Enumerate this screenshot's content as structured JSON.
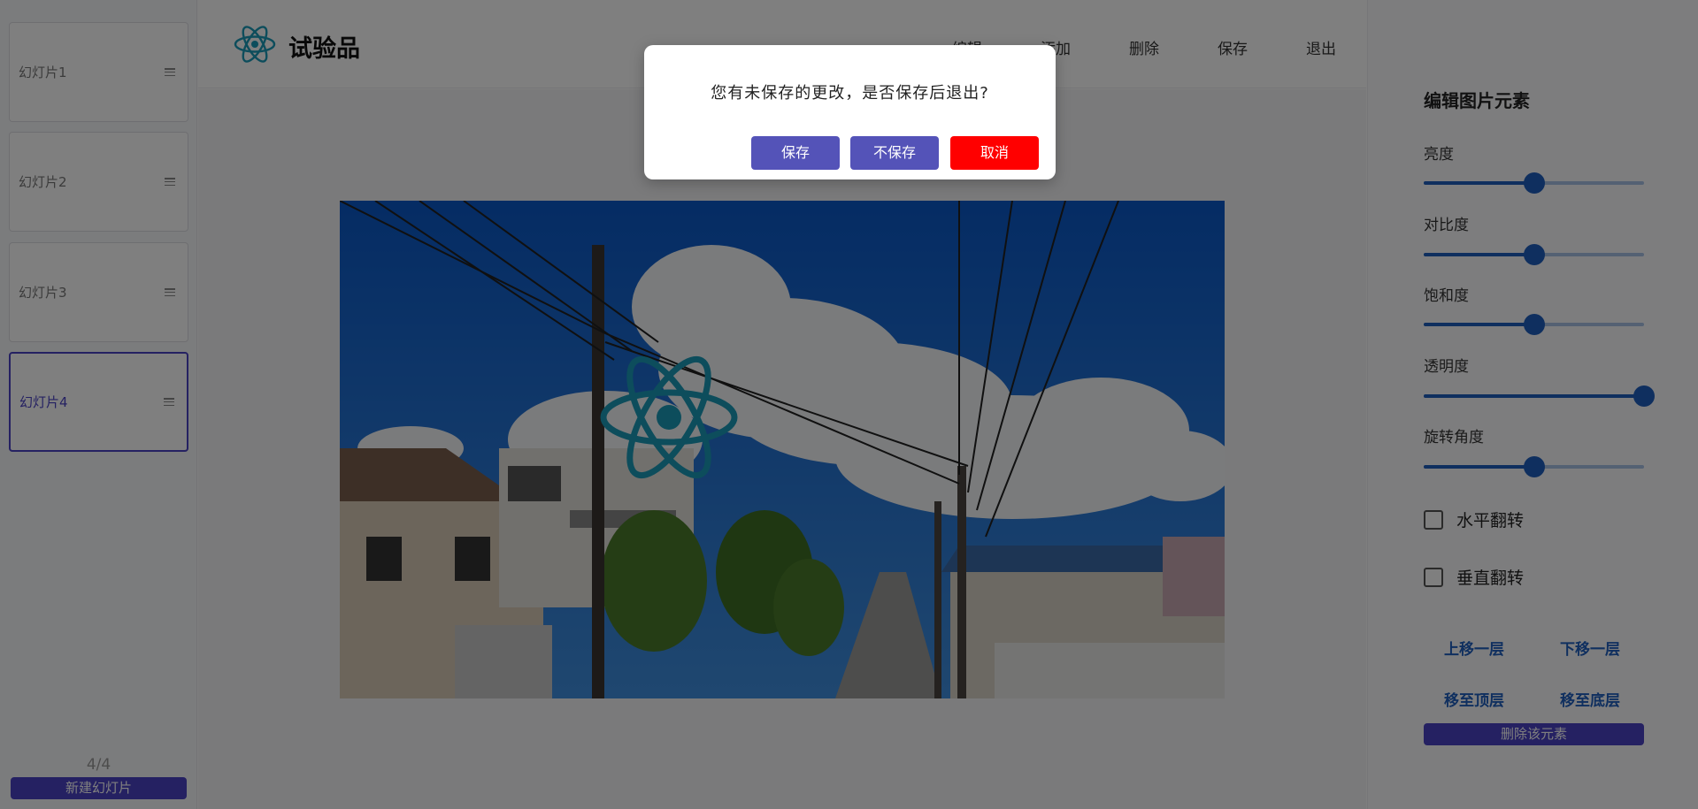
{
  "sidebar": {
    "slides": [
      {
        "label": "幻灯片1"
      },
      {
        "label": "幻灯片2"
      },
      {
        "label": "幻灯片3"
      },
      {
        "label": "幻灯片4"
      }
    ],
    "active_slide": 4,
    "counter": "4/4",
    "new_slide_label": "新建幻灯片"
  },
  "header": {
    "logo_icon": "react-atom-icon",
    "title": "试验品",
    "menu": [
      {
        "label": "编辑"
      },
      {
        "label": "添加"
      },
      {
        "label": "删除"
      },
      {
        "label": "保存"
      },
      {
        "label": "退出"
      }
    ]
  },
  "canvas": {
    "image_description_icon": "street-photo",
    "overlay_icon": "react-atom-icon"
  },
  "properties": {
    "title": "编辑图片元素",
    "sliders": [
      {
        "label": "亮度",
        "value": 0.5
      },
      {
        "label": "对比度",
        "value": 0.5
      },
      {
        "label": "饱和度",
        "value": 0.5
      },
      {
        "label": "透明度",
        "value": 1.0
      },
      {
        "label": "旋转角度",
        "value": 0.5
      }
    ],
    "checkboxes": [
      {
        "label": "水平翻转",
        "checked": false
      },
      {
        "label": "垂直翻转",
        "checked": false
      }
    ],
    "layer_buttons": {
      "up": "上移一层",
      "down": "下移一层",
      "top": "移至顶层",
      "bottom": "移至底层"
    },
    "delete_label": "删除该元素"
  },
  "dialog": {
    "message": "您有未保存的更改，是否保存后退出?",
    "save_label": "保存",
    "dont_save_label": "不保存",
    "cancel_label": "取消"
  },
  "colors": {
    "accent": "#4a42c4",
    "slider_blue": "#1f5fbf",
    "dialog_button": "#5453b8",
    "cancel_red": "#ff0000",
    "react_teal": "#1a9bb8"
  }
}
